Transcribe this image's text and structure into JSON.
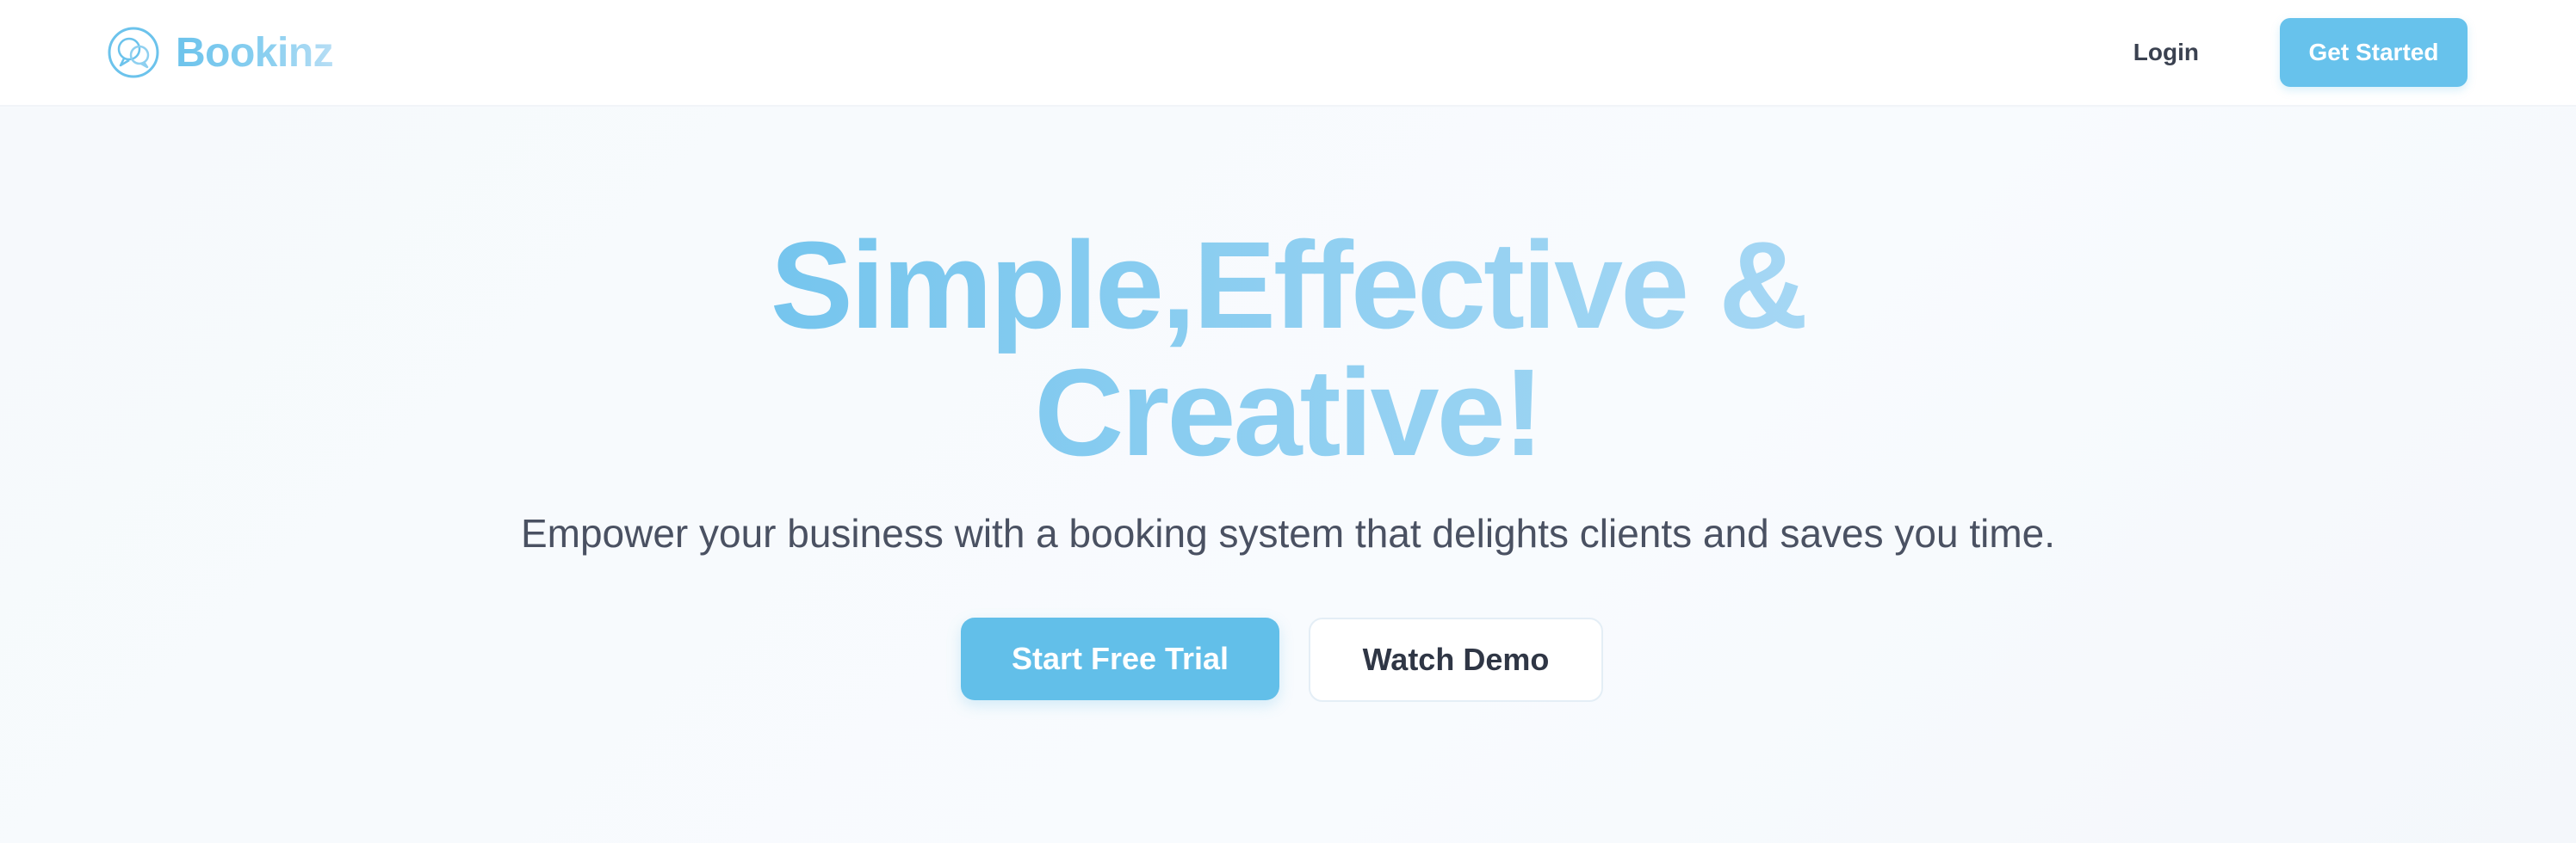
{
  "brand": {
    "name": "Bookinz",
    "logo_icon": "chat-bubble-logo-icon",
    "accent_color": "#67c2ec"
  },
  "nav": {
    "login_label": "Login",
    "cta_label": "Get Started"
  },
  "hero": {
    "title_line1": "Simple,Effective &",
    "title_line2": "Creative!",
    "subtitle": "Empower your business with a booking system that delights clients and saves you time.",
    "primary_cta": "Start Free Trial",
    "secondary_cta": "Watch Demo"
  }
}
